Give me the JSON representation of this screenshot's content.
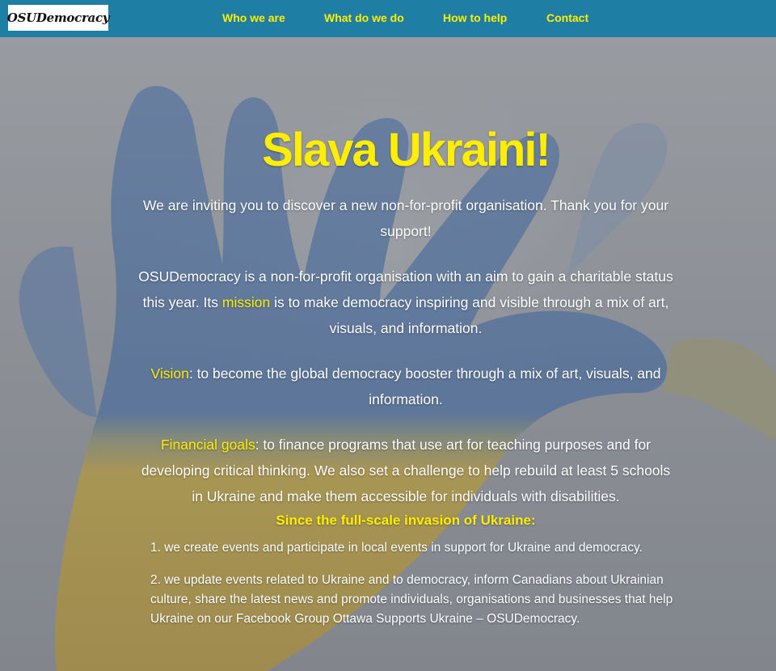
{
  "navbar": {
    "logo": "OSUDemocracy",
    "links": [
      "Who we are",
      "What do we do",
      "How to help",
      "Contact"
    ]
  },
  "hero": {
    "title": "Slava Ukraini!",
    "intro": "We are inviting you to discover a new non-for-profit organisation. Thank you for your support!",
    "about": {
      "before": "OSUDemocracy is a non-for-profit organisation with an aim to gain a charitable status this year. Its ",
      "link": "mission",
      "after": " is to make democracy inspiring and visible through a mix of art, visuals, and information."
    },
    "vision": {
      "label": "Vision",
      "text": ": to become the global democracy booster through a mix of art, visuals, and information."
    },
    "financial": {
      "label": "Financial goals",
      "text": ": to finance programs that use art for teaching purposes and for developing critical thinking. We also set a challenge to help rebuild at least 5 schools in Ukraine and make them accessible for individuals with disabilities."
    },
    "since_heading": "Since the full-scale invasion of Ukraine:",
    "list": [
      "1. we create events and participate in local events in support for Ukraine and democracy.",
      "2. we update events related to Ukraine and to democracy, inform Canadians about Ukrainian culture, share the latest news and promote individuals, organisations and businesses that help Ukraine on our Facebook Group Ottawa Supports Ukraine – OSUDemocracy."
    ]
  },
  "colors": {
    "navbar_bg": "#1f7ea3",
    "accent_yellow": "#ffee00",
    "hand_blue": "#5f86b8",
    "hand_yellow": "#d6b84a"
  }
}
